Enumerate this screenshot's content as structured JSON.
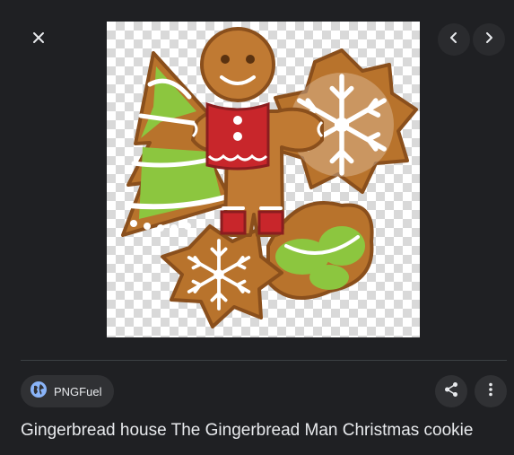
{
  "viewer": {
    "source_name": "PNGFuel",
    "image_title": "Gingerbread house The Gingerbread Man Christmas cookie"
  },
  "icons": {
    "close": "close-icon",
    "prev": "chevron-left-icon",
    "next": "chevron-right-icon",
    "source": "globe-icon",
    "share": "share-icon",
    "more": "more-vert-icon"
  },
  "colors": {
    "background": "#1f2023",
    "chip": "#303134",
    "text": "#e8eaed",
    "globe": "#8ab4f8"
  }
}
